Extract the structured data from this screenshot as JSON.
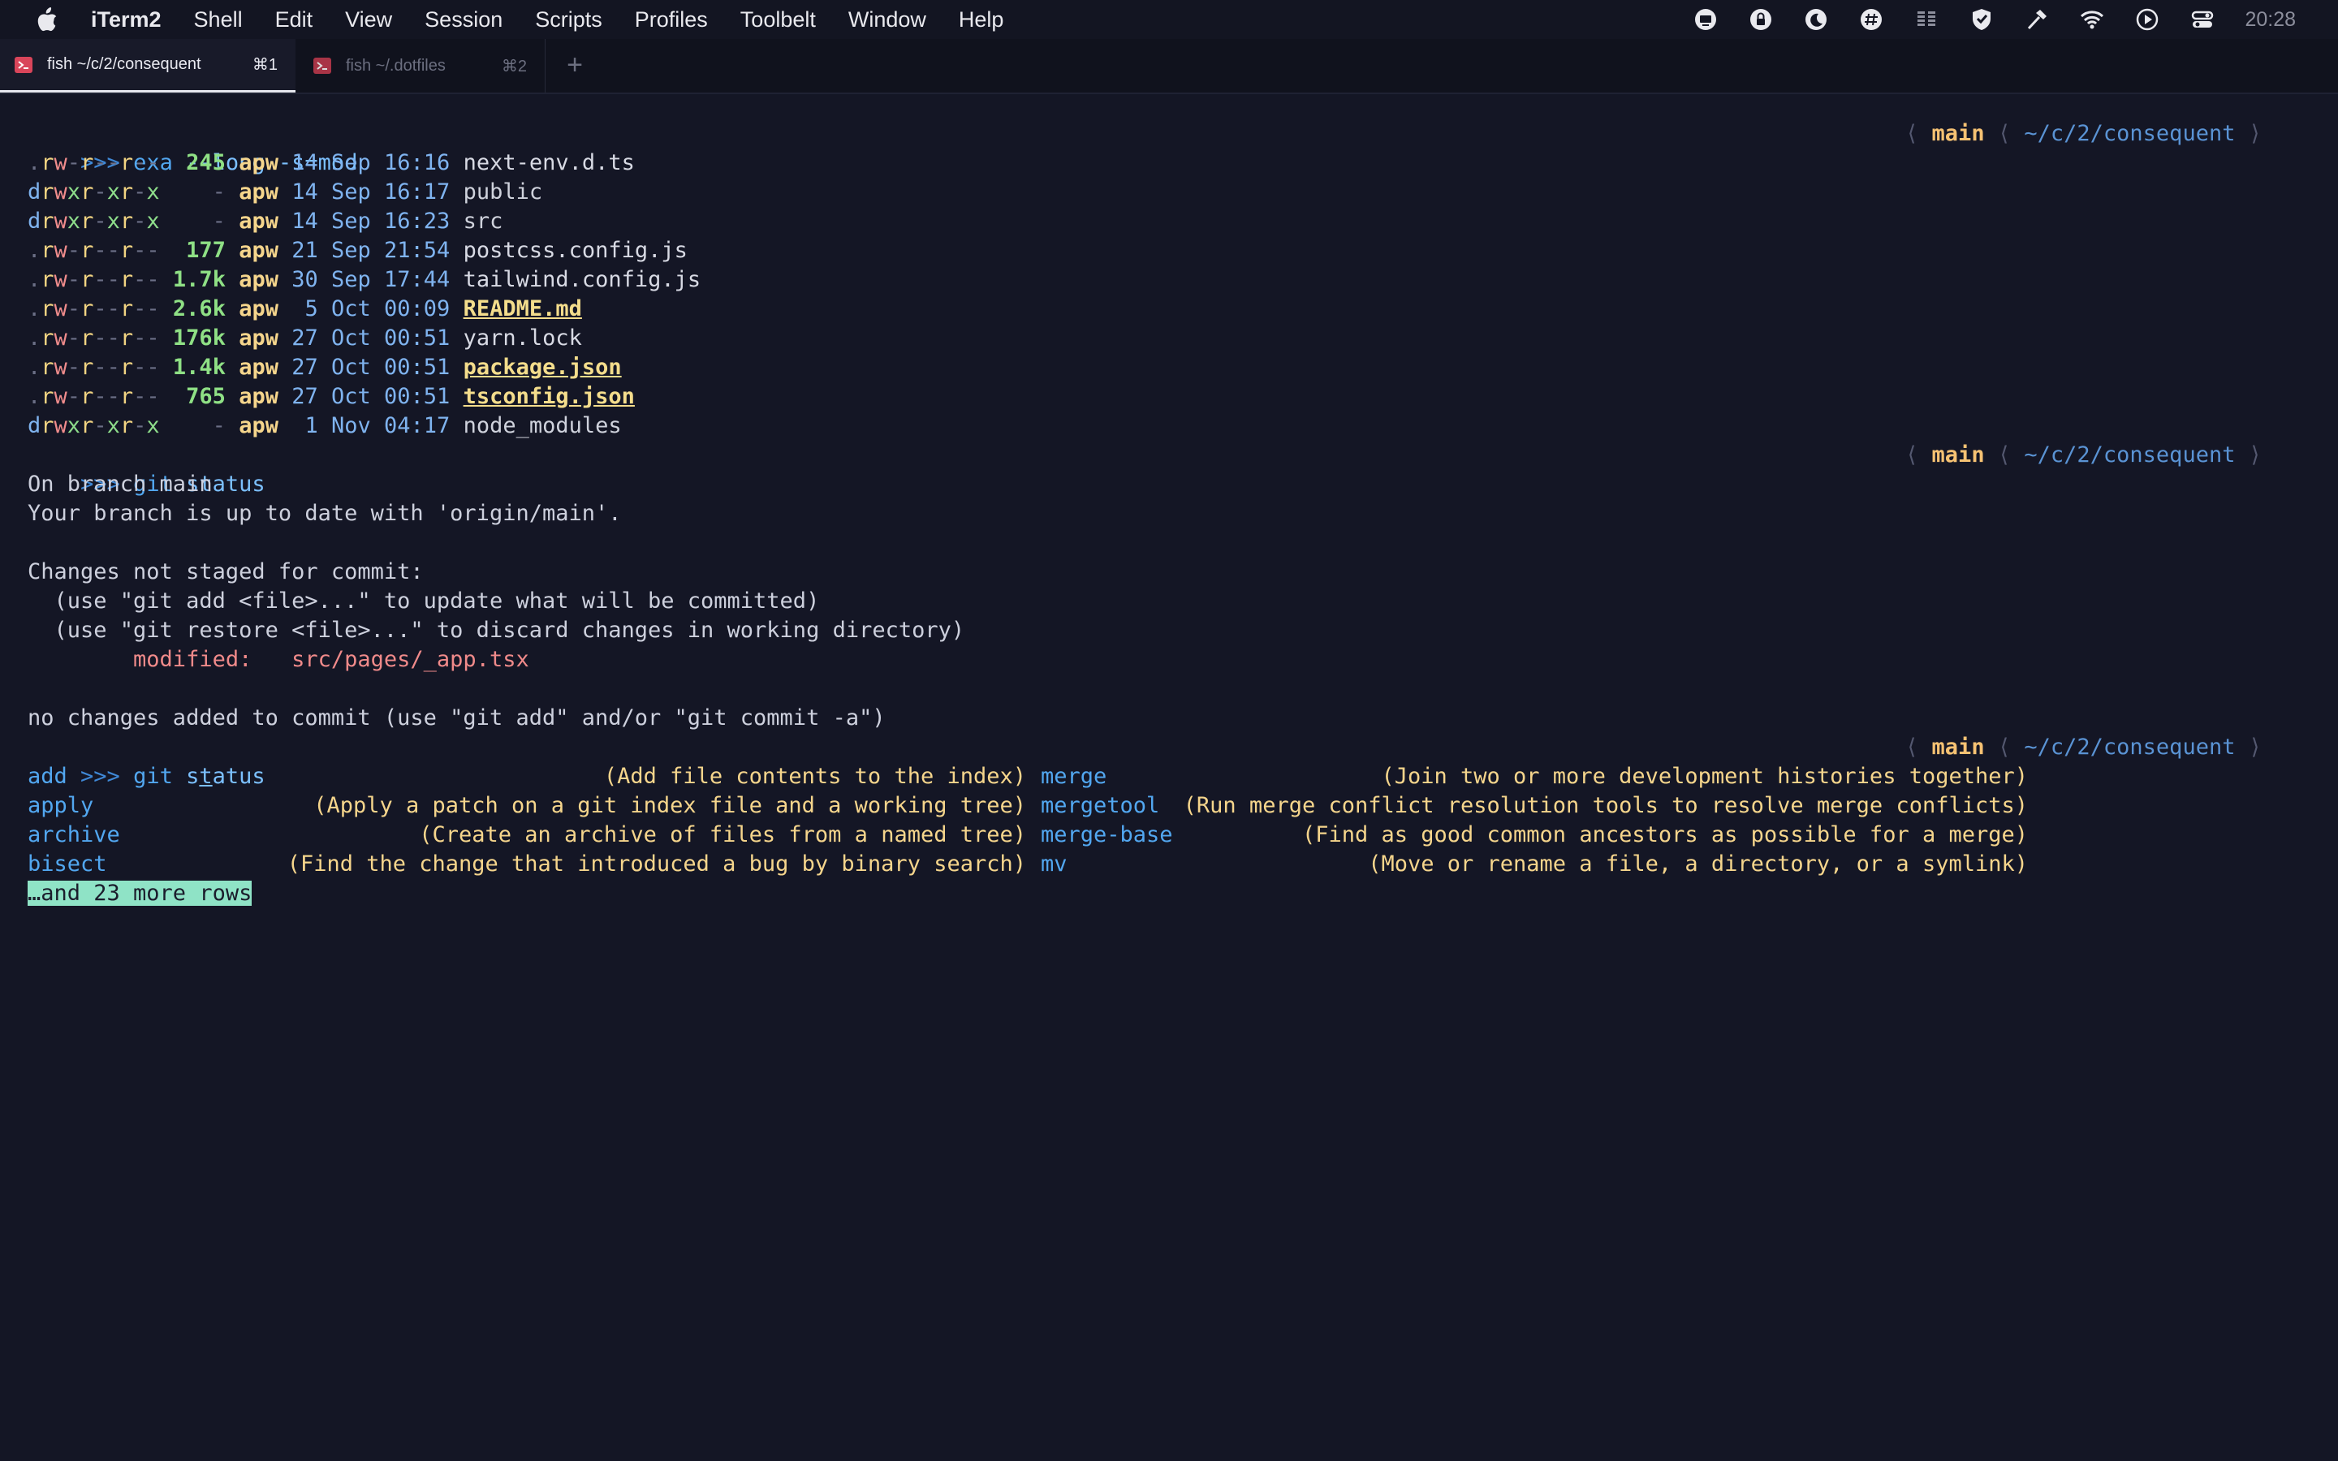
{
  "menubar": {
    "app_name": "iTerm2",
    "items": [
      "Shell",
      "Edit",
      "View",
      "Session",
      "Scripts",
      "Profiles",
      "Toolbelt",
      "Window",
      "Help"
    ],
    "status_icons": [
      "screen-icon",
      "lock-icon",
      "moon-icon",
      "hash-icon",
      "bars-icon",
      "shield-icon",
      "hammer-icon",
      "wifi-icon",
      "play-icon",
      "control-center-icon"
    ],
    "clock": "20:28"
  },
  "tabs": [
    {
      "title": "fish ~/c/2/consequent",
      "shortcut": "⌘1",
      "active": true
    },
    {
      "title": "fish ~/.dotfiles",
      "shortcut": "⌘2",
      "active": false
    }
  ],
  "new_tab_label": "+",
  "prompt": {
    "symbol": ">>>",
    "branch": "main",
    "path": "~/c/2/consequent",
    "left_bracket": "⟨",
    "right_bracket": "⟩"
  },
  "cmd1": {
    "name": "exa",
    "args": "--long -s=mod"
  },
  "listing": [
    {
      "perms": ".rw-r--r--",
      "size": "245",
      "user": "apw",
      "date": "14 Sep 16:16",
      "name": "next-env.d.ts",
      "kind": "file"
    },
    {
      "perms": "drwxr-xr-x",
      "size": "-",
      "user": "apw",
      "date": "14 Sep 16:17",
      "name": "public",
      "kind": "dir"
    },
    {
      "perms": "drwxr-xr-x",
      "size": "-",
      "user": "apw",
      "date": "14 Sep 16:23",
      "name": "src",
      "kind": "dir"
    },
    {
      "perms": ".rw-r--r--",
      "size": "177",
      "user": "apw",
      "date": "21 Sep 21:54",
      "name": "postcss.config.js",
      "kind": "file"
    },
    {
      "perms": ".rw-r--r--",
      "size": "1.7k",
      "user": "apw",
      "date": "30 Sep 17:44",
      "name": "tailwind.config.js",
      "kind": "file"
    },
    {
      "perms": ".rw-r--r--",
      "size": "2.6k",
      "user": "apw",
      "date": " 5 Oct 00:09",
      "name": "README.md",
      "kind": "special"
    },
    {
      "perms": ".rw-r--r--",
      "size": "176k",
      "user": "apw",
      "date": "27 Oct 00:51",
      "name": "yarn.lock",
      "kind": "file"
    },
    {
      "perms": ".rw-r--r--",
      "size": "1.4k",
      "user": "apw",
      "date": "27 Oct 00:51",
      "name": "package.json",
      "kind": "special"
    },
    {
      "perms": ".rw-r--r--",
      "size": "765",
      "user": "apw",
      "date": "27 Oct 00:51",
      "name": "tsconfig.json",
      "kind": "special"
    },
    {
      "perms": "drwxr-xr-x",
      "size": "-",
      "user": "apw",
      "date": " 1 Nov 04:17",
      "name": "node_modules",
      "kind": "dir"
    }
  ],
  "cmd2": {
    "name": "git",
    "args": "status"
  },
  "git_status": {
    "branch_line": "On branch main",
    "uptodate_line": "Your branch is up to date with 'origin/main'.",
    "changes_header": "Changes not staged for commit:",
    "hint1": "  (use \"git add <file>...\" to update what will be committed)",
    "hint2": "  (use \"git restore <file>...\" to discard changes in working directory)",
    "modified_label": "        modified:   ",
    "modified_file": "src/pages/_app.tsx",
    "footer": "no changes added to commit (use \"git add\" and/or \"git commit -a\")"
  },
  "cmd3": {
    "name": "git",
    "pre": "s",
    "cursor": "t",
    "post": "atus"
  },
  "completions": [
    {
      "left_cmd": "add",
      "left_desc": "(Add file contents to the index)",
      "right_cmd": "merge",
      "right_desc": "(Join two or more development histories together)"
    },
    {
      "left_cmd": "apply",
      "left_desc": "(Apply a patch on a git index file and a working tree)",
      "right_cmd": "mergetool",
      "right_desc": "(Run merge conflict resolution tools to resolve merge conflicts)"
    },
    {
      "left_cmd": "archive",
      "left_desc": "(Create an archive of files from a named tree)",
      "right_cmd": "merge-base",
      "right_desc": "(Find as good common ancestors as possible for a merge)"
    },
    {
      "left_cmd": "bisect",
      "left_desc": "(Find the change that introduced a bug by binary search)",
      "right_cmd": "mv",
      "right_desc": "(Move or rename a file, a directory, or a symlink)"
    }
  ],
  "more_rows": "…and 23 more rows"
}
